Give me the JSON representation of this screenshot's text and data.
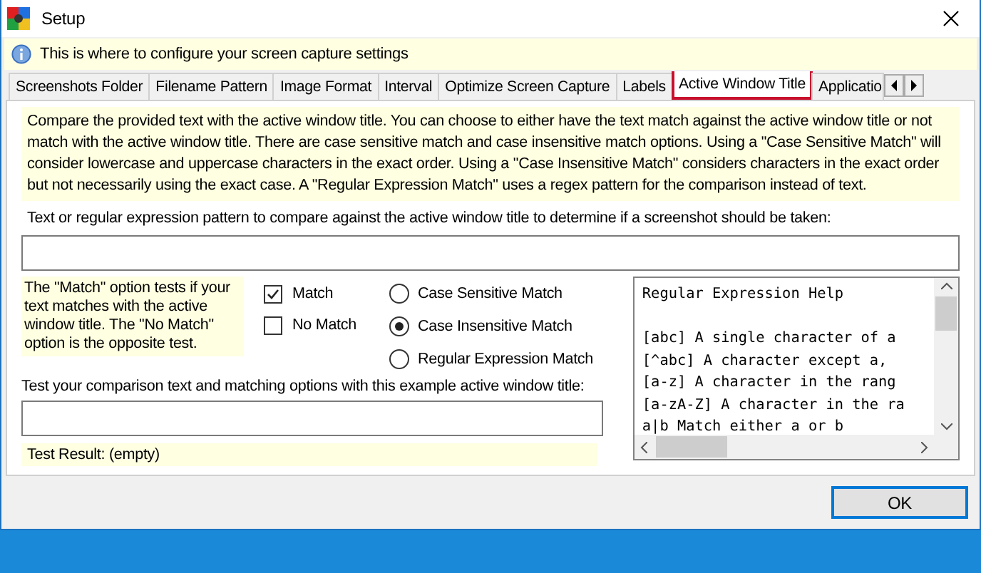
{
  "window": {
    "title": "Setup"
  },
  "info_bar": {
    "text": "This is where to configure your screen capture settings"
  },
  "tabs": [
    {
      "label": "Screenshots Folder",
      "selected": false
    },
    {
      "label": "Filename Pattern",
      "selected": false
    },
    {
      "label": "Image Format",
      "selected": false
    },
    {
      "label": "Interval",
      "selected": false
    },
    {
      "label": "Optimize Screen Capture",
      "selected": false
    },
    {
      "label": "Labels",
      "selected": false
    },
    {
      "label": "Active Window Title",
      "selected": true
    },
    {
      "label": "Applicatio",
      "selected": false
    }
  ],
  "description": "Compare the provided text with the active window title. You can choose to either have the text match against the active window title or not match with the active window title. There are case sensitive match and case insensitive match options. Using a \"Case Sensitive Match\" will consider lowercase and uppercase characters in the exact order. Using a \"Case Insensitive Match\" considers characters in the exact order but not necessarily using the exact case. A \"Regular Expression Match\" uses a regex pattern for the comparison instead of text.",
  "pattern_label": "Text or regular expression pattern to compare against the active window title to determine if a screenshot should be taken:",
  "match_help": "The \"Match\" option tests if your text matches with the active window title. The \"No Match\" option is the opposite test.",
  "match_options": [
    {
      "label": "Match",
      "checked": true
    },
    {
      "label": "No Match",
      "checked": false
    }
  ],
  "case_options": [
    {
      "label": "Case Sensitive Match",
      "selected": false
    },
    {
      "label": "Case Insensitive Match",
      "selected": true
    },
    {
      "label": "Regular Expression Match",
      "selected": false
    }
  ],
  "test_label": "Test your comparison text and matching options with this example active window title:",
  "test_result": "Test Result: (empty)",
  "regex_help": {
    "title": "Regular Expression Help",
    "lines": [
      "[abc] A single character of a",
      "[^abc] A character except a,",
      "[a-z] A character in the rang",
      "[a-zA-Z] A character in the ra",
      "a|b Match either a or b"
    ]
  },
  "ok_button": "OK"
}
